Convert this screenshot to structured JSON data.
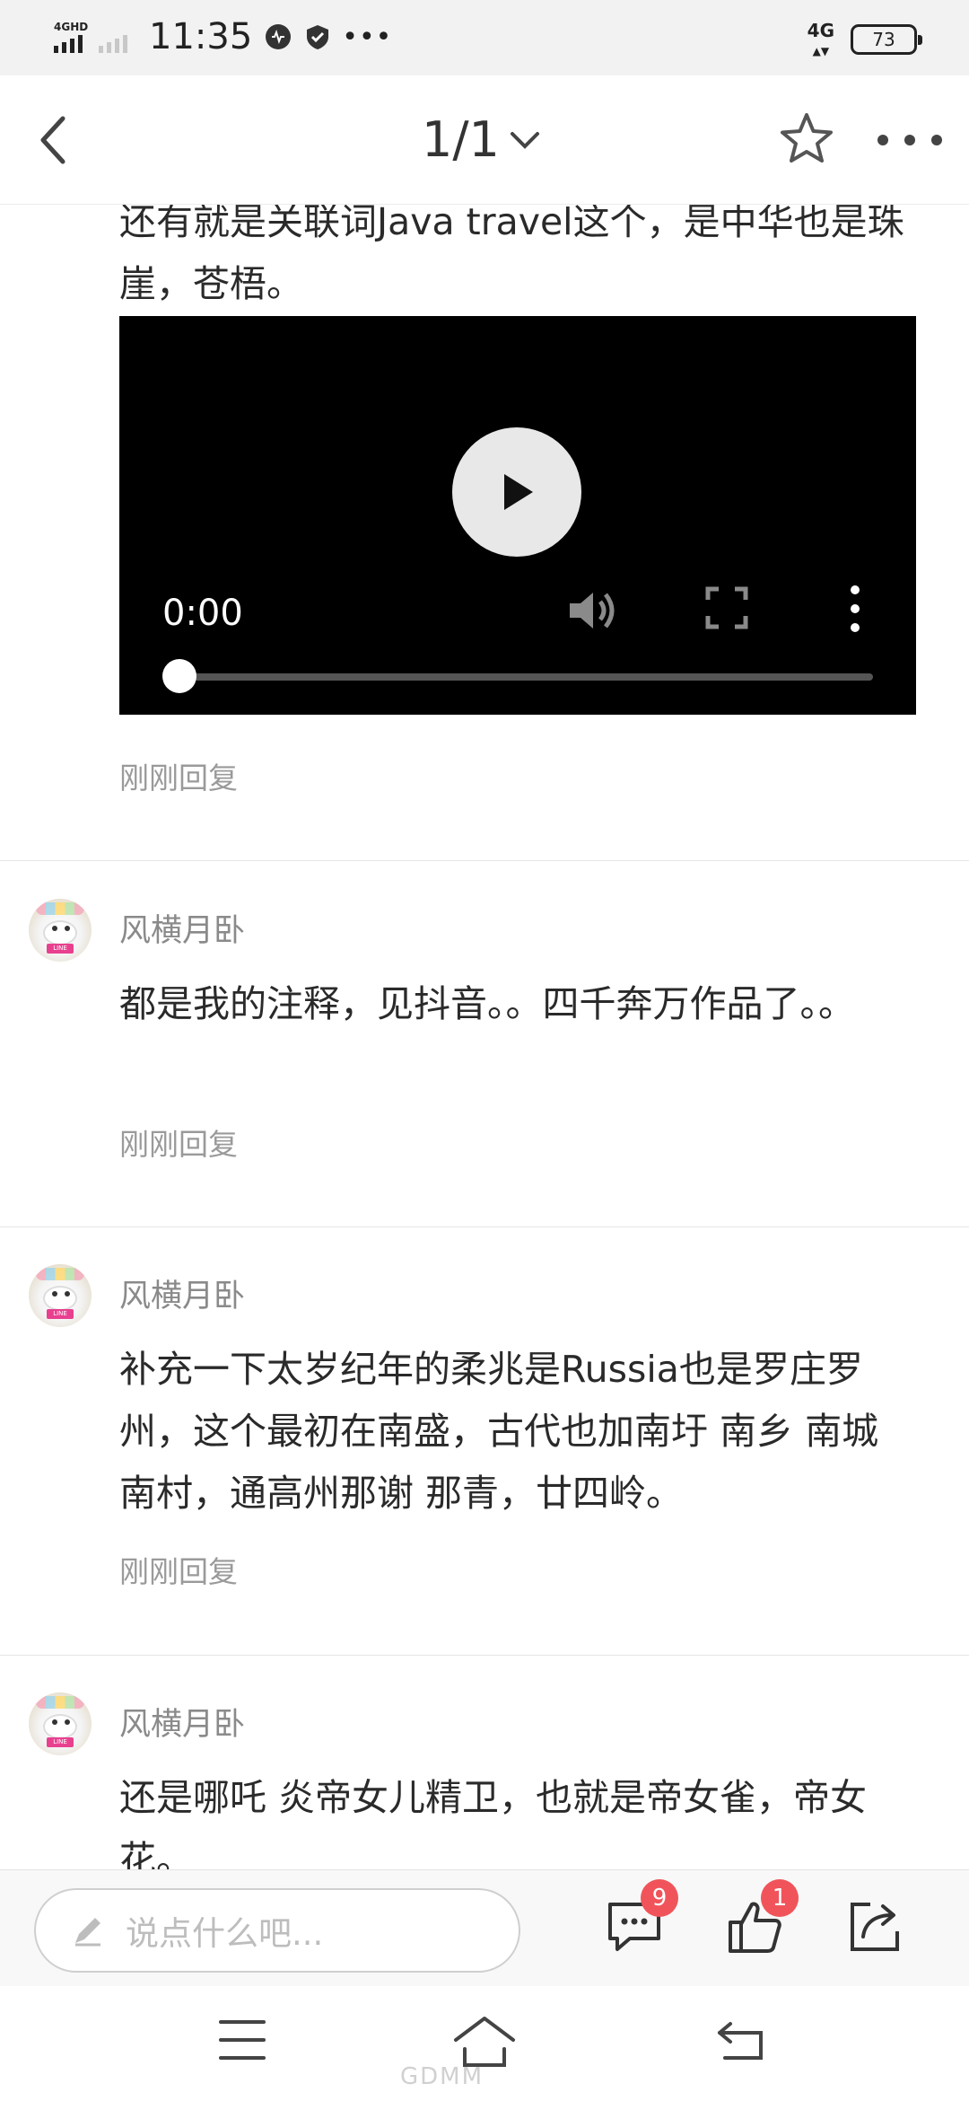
{
  "status_bar": {
    "network_left": "4GHD",
    "time": "11:35",
    "network_right": "4G",
    "battery": "73"
  },
  "header": {
    "page_indicator": "1/1"
  },
  "post": {
    "text": "还有就是关联词Java travel这个，是中华也是珠崖，苍梧。",
    "video": {
      "current_time": "0:00",
      "progress": 0
    },
    "reply_time": "刚刚回复"
  },
  "comments": [
    {
      "username": "风横月卧",
      "text": "都是我的注释，见抖音。。四千奔万作品了。。",
      "reply_time": "刚刚回复"
    },
    {
      "username": "风横月卧",
      "text": "补充一下太岁纪年的柔兆是Russia也是罗庄罗州，这个最初在南盛，古代也加南圩 南乡 南城 南村，通高州那谢 那青，廿四岭。",
      "reply_time": "刚刚回复"
    },
    {
      "username": "风横月卧",
      "text": "还是哪吒 炎帝女儿精卫，也就是帝女雀，帝女花。"
    }
  ],
  "action_bar": {
    "input_placeholder": "说点什么吧...",
    "comment_count": "9",
    "like_count": "1"
  },
  "watermark": "GDMM"
}
